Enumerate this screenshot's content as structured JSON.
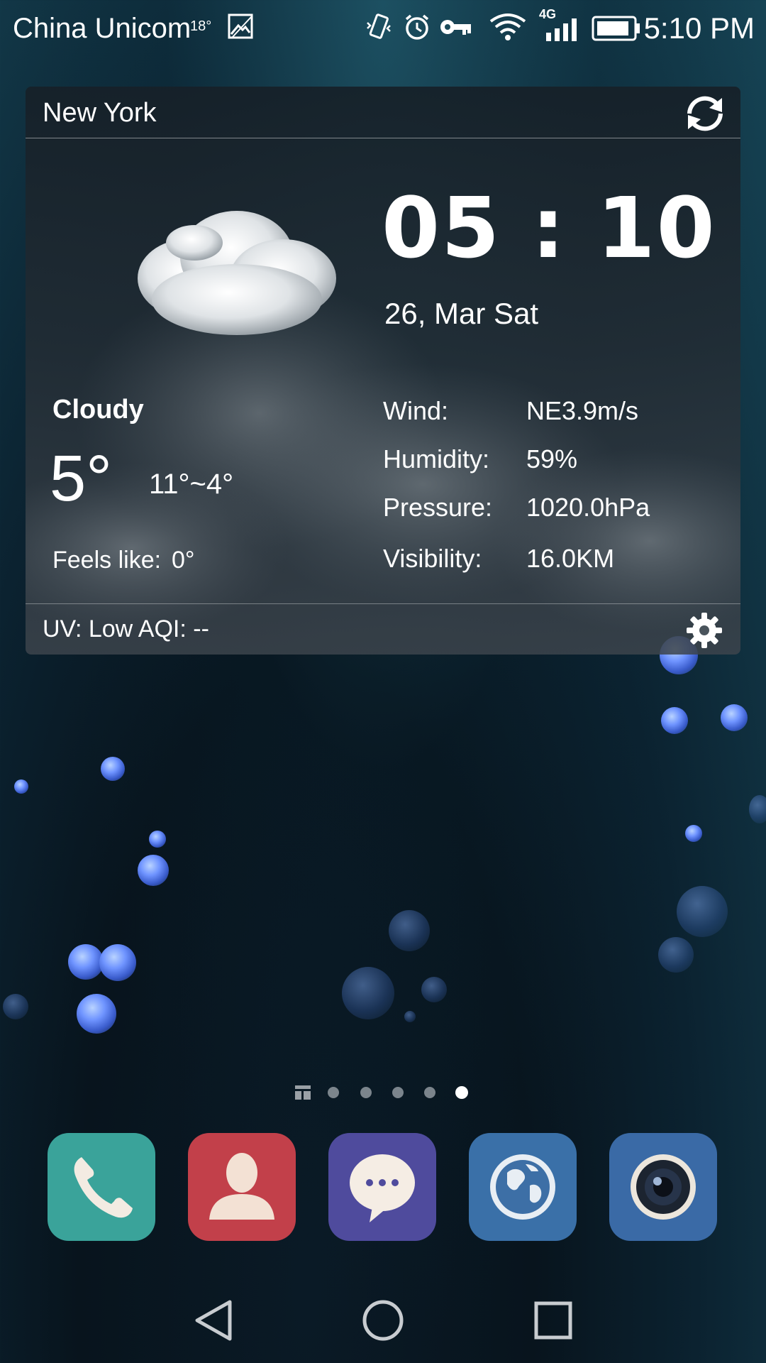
{
  "status_bar": {
    "carrier": "China Unicom",
    "carrier_temp": "18°",
    "network_type": "4G",
    "time": "5:10 PM",
    "icons": [
      "image-icon",
      "vibrate-icon",
      "alarm-icon",
      "vpn-key-icon",
      "wifi-icon",
      "signal-icon",
      "battery-icon"
    ]
  },
  "weather_widget": {
    "city": "New York",
    "time": "05 : 10",
    "date": "26, Mar Sat",
    "condition": "Cloudy",
    "temperature": "5°",
    "temp_range": "11°~4°",
    "feels_like_label": "Feels like:",
    "feels_like_value": "0°",
    "details": [
      {
        "label": "Wind:",
        "value": "NE3.9m/s"
      },
      {
        "label": "Humidity:",
        "value": "59%"
      },
      {
        "label": "Pressure:",
        "value": "1020.0hPa"
      },
      {
        "label": "Visibility:",
        "value": "16.0KM"
      }
    ],
    "footer": "UV:  Low  AQI:  --"
  },
  "page_indicator": {
    "pages": 5,
    "active_page": 5
  },
  "dock": [
    {
      "name": "Phone",
      "icon": "phone-icon",
      "color": "#3aa39a"
    },
    {
      "name": "Contacts",
      "icon": "contact-icon",
      "color": "#c2404a"
    },
    {
      "name": "Messages",
      "icon": "message-icon",
      "color": "#4f4b9d"
    },
    {
      "name": "Browser",
      "icon": "globe-icon",
      "color": "#3a70a8"
    },
    {
      "name": "Camera",
      "icon": "camera-icon",
      "color": "#3a6aa6"
    }
  ],
  "nav_bar": [
    "back-icon",
    "home-icon",
    "recents-icon"
  ]
}
